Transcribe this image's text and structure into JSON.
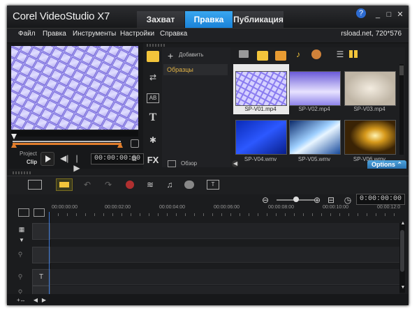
{
  "app": {
    "title": "Corel VideoStudio X7",
    "tabs": [
      {
        "label": "Захват"
      },
      {
        "label": "Правка"
      },
      {
        "label": "Публикация"
      }
    ],
    "window_buttons": {
      "help": "?",
      "minimize": "_",
      "maximize": "□",
      "close": "✕"
    }
  },
  "menu": {
    "items": [
      "Файл",
      "Правка",
      "Инструменты",
      "Настройки",
      "Справка"
    ],
    "info": "rsload.net, 720*576"
  },
  "preview": {
    "project_label": "Project",
    "clip_label": "Clip",
    "timecode": "00:00:00:00"
  },
  "library": {
    "add_label": "Добавить",
    "folder_label": "Образцы",
    "browse_label": "Обзор",
    "options_label": "Options",
    "thumbnails": [
      {
        "name": "SP-V01.mp4"
      },
      {
        "name": "SP-V02.mp4"
      },
      {
        "name": "SP-V03.mp4"
      },
      {
        "name": "SP-V04.wmv"
      },
      {
        "name": "SP-V05.wmv"
      },
      {
        "name": "SP-V06.wmv"
      }
    ],
    "side_icons": [
      "media-icon",
      "transition-icon",
      "title-text-icon",
      "text-icon",
      "graphics-icon",
      "fx-icon"
    ],
    "side_fx_label": "FX"
  },
  "timeline": {
    "timecode": "0:00:00:00",
    "ruler_ticks": [
      "00:00:00:00",
      "00:00:02:00",
      "00:00:04:00",
      "00:00:06:00",
      "00:00:08:00",
      "00:00:10:00",
      "00:00:12:0"
    ]
  },
  "colors": {
    "accent": "#1a82d8",
    "trim_orange": "#e07d2c",
    "folder_text": "#e3b445"
  }
}
